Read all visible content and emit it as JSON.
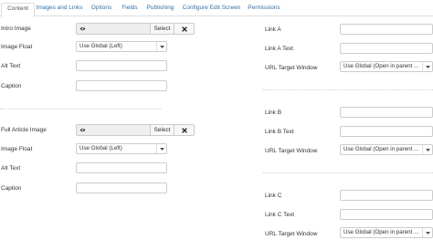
{
  "tabs": [
    "Content",
    "Images and Links",
    "Options",
    "Fields",
    "Publishing",
    "Configure Edit Screen",
    "Permissions"
  ],
  "left": {
    "intro_image_label": "Intro Image",
    "intro_select_label": "Select",
    "intro_float_label": "Image Float",
    "intro_float_value": "Use Global (Left)",
    "intro_alt_label": "Alt Text",
    "intro_caption_label": "Caption",
    "full_image_label": "Full Article Image",
    "full_select_label": "Select",
    "full_float_label": "Image Float",
    "full_float_value": "Use Global (Left)",
    "full_alt_label": "Alt Text",
    "full_caption_label": "Caption"
  },
  "right": {
    "link_a_label": "Link A",
    "link_a_text_label": "Link A Text",
    "link_a_target_label": "URL Target Window",
    "link_a_target_value": "Use Global (Open in parent ...",
    "link_b_label": "Link B",
    "link_b_text_label": "Link B Text",
    "link_b_target_label": "URL Target Window",
    "link_b_target_value": "Use Global (Open in parent ...",
    "link_c_label": "Link C",
    "link_c_text_label": "Link C Text",
    "link_c_target_label": "URL Target Window",
    "link_c_target_value": "Use Global (Open in parent ..."
  },
  "icons": {
    "preview": "eye-icon",
    "clear": "close-icon",
    "dropdown": "caret-down-icon"
  }
}
